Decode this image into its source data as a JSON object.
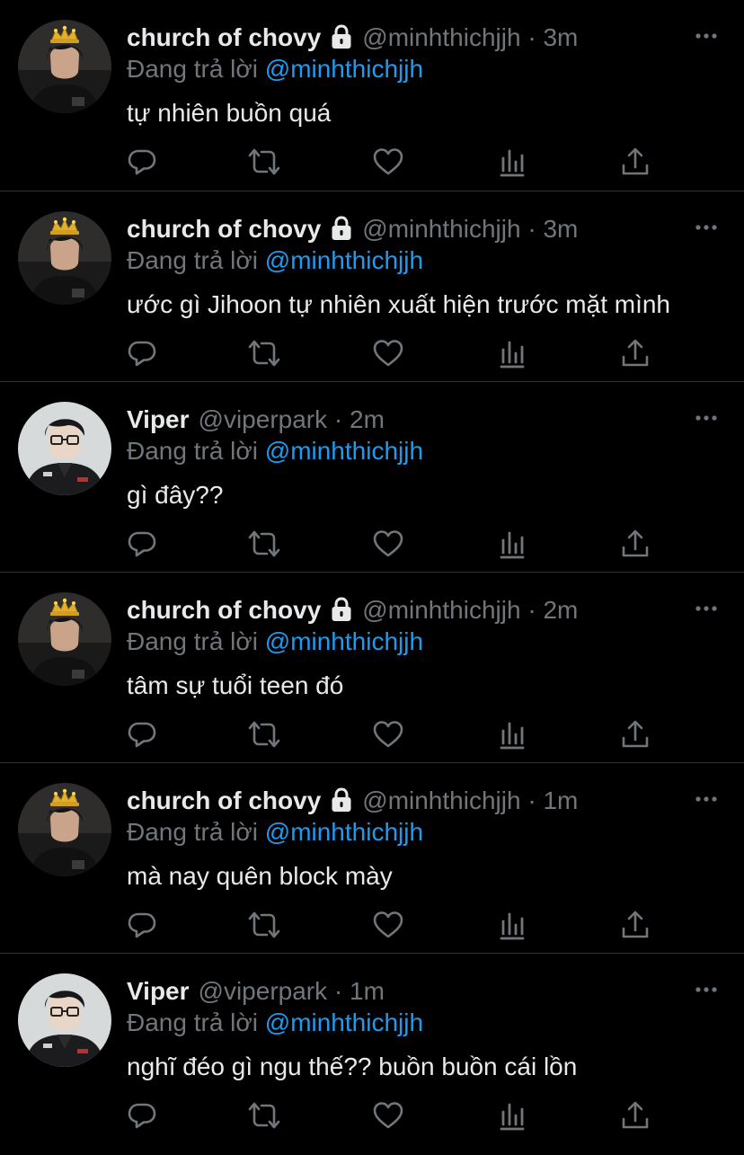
{
  "theme": {
    "background": "#000000",
    "text": "#e7e9ea",
    "muted": "#71767b",
    "link": "#1d9bf0",
    "divider": "#2f3336"
  },
  "tweets": [
    {
      "display_name": "church of chovy",
      "locked": true,
      "handle": "@minhthichjjh",
      "dot": "·",
      "time": "3m",
      "reply_prefix": "Đang trả lời",
      "reply_to": "@minhthichjjh",
      "text": "tự nhiên buồn quá",
      "avatar_icon": "crown-avatar"
    },
    {
      "display_name": "church of chovy",
      "locked": true,
      "handle": "@minhthichjjh",
      "dot": "·",
      "time": "3m",
      "reply_prefix": "Đang trả lời",
      "reply_to": "@minhthichjjh",
      "text": "ước gì Jihoon tự nhiên xuất hiện trước mặt mình",
      "avatar_icon": "crown-avatar"
    },
    {
      "display_name": "Viper",
      "locked": false,
      "handle": "@viperpark",
      "dot": "·",
      "time": "2m",
      "reply_prefix": "Đang trả lời",
      "reply_to": "@minhthichjjh",
      "text": "gì đây??",
      "avatar_icon": "glasses-avatar"
    },
    {
      "display_name": "church of chovy",
      "locked": true,
      "handle": "@minhthichjjh",
      "dot": "·",
      "time": "2m",
      "reply_prefix": "Đang trả lời",
      "reply_to": "@minhthichjjh",
      "text": "tâm sự tuổi teen đó",
      "avatar_icon": "crown-avatar"
    },
    {
      "display_name": "church of chovy",
      "locked": true,
      "handle": "@minhthichjjh",
      "dot": "·",
      "time": "1m",
      "reply_prefix": "Đang trả lời",
      "reply_to": "@minhthichjjh",
      "text": "mà nay quên block mày",
      "avatar_icon": "crown-avatar"
    },
    {
      "display_name": "Viper",
      "locked": false,
      "handle": "@viperpark",
      "dot": "·",
      "time": "1m",
      "reply_prefix": "Đang trả lời",
      "reply_to": "@minhthichjjh",
      "text": "nghĩ đéo gì ngu thế?? buồn buồn cái lồn",
      "avatar_icon": "glasses-avatar"
    }
  ]
}
